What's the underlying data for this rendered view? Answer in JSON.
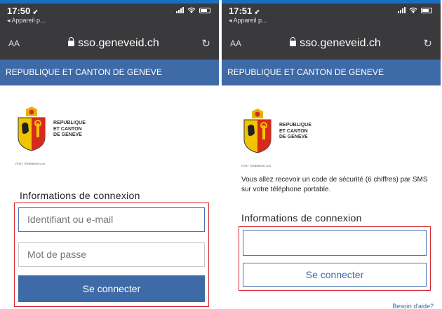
{
  "left": {
    "status_time": "17:50",
    "back_label": "◂ Appareil p...",
    "text_size_label": "AA",
    "url": "sso.geneveid.ch",
    "banner_title": "REPUBLIQUE ET CANTON DE GENEVE",
    "logo_line1": "REPUBLIQUE",
    "logo_line2": "ET CANTON",
    "logo_line3": "DE GENEVE",
    "motto": "POST TENEBRAS LUX",
    "section_title": "Informations de connexion",
    "username_placeholder": "Identifiant ou e-mail",
    "password_placeholder": "Mot de passe",
    "submit_label": "Se connecter"
  },
  "right": {
    "status_time": "17:51",
    "back_label": "◂ Appareil p...",
    "text_size_label": "AA",
    "url": "sso.geneveid.ch",
    "banner_title": "REPUBLIQUE ET CANTON DE GENEVE",
    "logo_line1": "REPUBLIQUE",
    "logo_line2": "ET CANTON",
    "logo_line3": "DE GENEVE",
    "motto": "POST TENEBRAS LUX",
    "sms_info": "Vous allez recevoir un code de sécurité (6 chiffres) par SMS sur votre téléphone portable.",
    "section_title": "Informations de connexion",
    "code_value": "",
    "submit_label": "Se connecter",
    "help_link": "Besoin d'aide?"
  },
  "colors": {
    "banner": "#3e6aa7",
    "browser_chrome": "#3a3a3c",
    "highlight_box": "#d9262e",
    "crest_red": "#d52b1e",
    "crest_yellow": "#f2c400"
  },
  "icons": [
    "location-arrow-icon",
    "signal-icon",
    "wifi-icon",
    "battery-icon",
    "lock-icon",
    "reload-icon",
    "geneva-crest-icon"
  ]
}
